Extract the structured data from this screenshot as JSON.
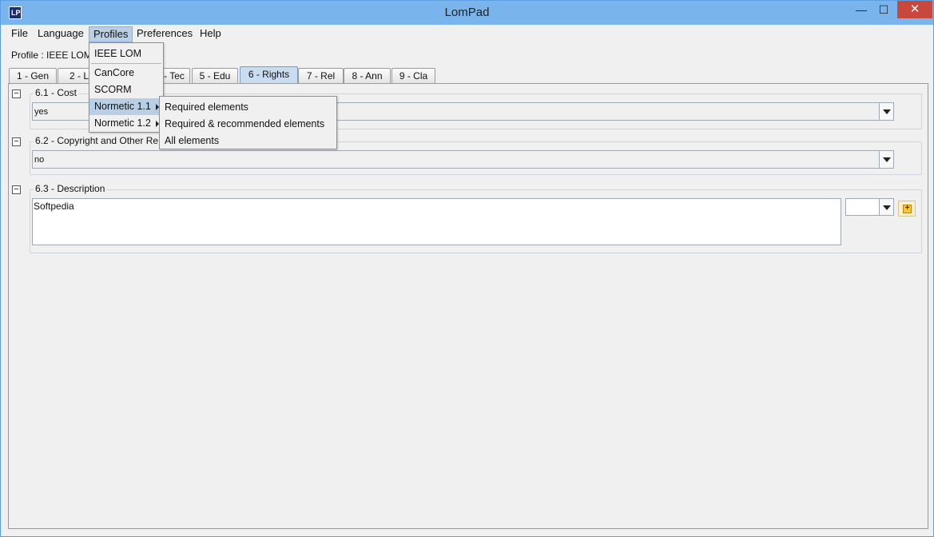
{
  "window": {
    "title": "LomPad",
    "icon_text": "LP"
  },
  "menubar": [
    "File",
    "Language",
    "Profiles",
    "Preferences",
    "Help"
  ],
  "profile_label": "Profile : IEEE LOM",
  "tabs": [
    "1 - Gen",
    "2 - Lif",
    "4 - Tec",
    "5 - Edu",
    "6 - Rights",
    "7 - Rel",
    "8 - Ann",
    "9 - Cla"
  ],
  "active_tab": "6 - Rights",
  "sections": {
    "cost": {
      "label": "6.1 - Cost",
      "value": "yes"
    },
    "copyright": {
      "label": "6.2 - Copyright and Other Re",
      "value": "no"
    },
    "description": {
      "label": "6.3 - Description",
      "text": "Softpedia",
      "lang_value": ""
    }
  },
  "profiles_menu": {
    "items": [
      "IEEE LOM",
      "CanCore",
      "SCORM",
      "Normetic 1.1",
      "Normetic 1.2"
    ],
    "highlighted": "Normetic 1.1"
  },
  "normetic_submenu": {
    "items": [
      "Required elements",
      "Required & recommended elements",
      "All elements"
    ]
  },
  "icons": {
    "minimize": "minimize-icon",
    "maximize": "maximize-icon",
    "close": "close-icon",
    "collapse": "collapse-icon",
    "dropdown_arrow": "chevron-down-icon",
    "add": "add-icon",
    "submenu_arrow": "chevron-right-icon"
  }
}
